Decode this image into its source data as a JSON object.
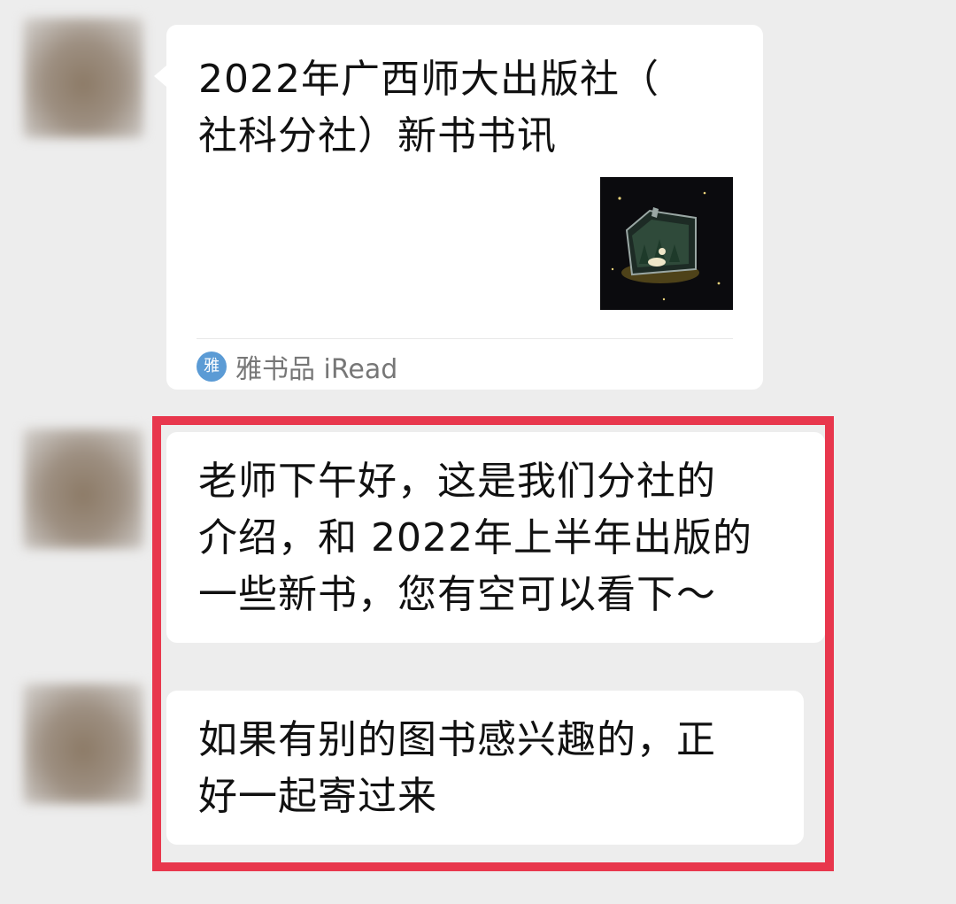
{
  "chat": {
    "messages": [
      {
        "type": "link-card",
        "title": "2022年广西师大出版社（\n社科分社）新书书讯",
        "source_icon_text": "雅",
        "source_name": "雅书品 iRead"
      },
      {
        "type": "text",
        "text": "老师下午好，这是我们分社的\n介绍，和 2022年上半年出版的\n一些新书，您有空可以看下～"
      },
      {
        "type": "text",
        "text": "如果有别的图书感兴趣的，正\n好一起寄过来"
      }
    ]
  },
  "colors": {
    "background": "#ededed",
    "bubble": "#ffffff",
    "highlight_border": "#e8374d",
    "source_icon": "#5b9bd5"
  }
}
